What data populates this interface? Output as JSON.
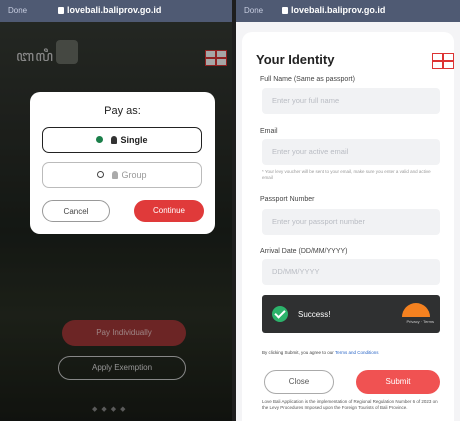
{
  "left": {
    "browser_label": "Done",
    "url": "lovebali.baliprov.go.id",
    "modal": {
      "title": "Pay as:",
      "option_single": "Single",
      "option_group": "Group",
      "cancel_label": "Cancel",
      "continue_label": "Continue"
    },
    "pay_individually": "Pay Individually",
    "apply_exemption": "Apply Exemption"
  },
  "right": {
    "browser_label": "Done",
    "url": "lovebali.baliprov.go.id",
    "heading": "Your Identity",
    "fields": {
      "full_name_label": "Full Name (Same as passport)",
      "full_name_placeholder": "Enter your full name",
      "email_label": "Email",
      "email_placeholder": "Enter your active email",
      "email_hint": "* Your levy voucher will be sent to your email, make sure you enter a valid and active email",
      "passport_label": "Passport Number",
      "passport_placeholder": "Enter your passport number",
      "arrival_label": "Arrival Date (DD/MM/YYYY)",
      "arrival_placeholder": "DD/MM/YYYY"
    },
    "captcha_status": "Success!",
    "captcha_brand": "Privacy · Terms",
    "terms_text": "By clicking Submit, you agree to our",
    "terms_link": "Terms and Conditions",
    "close_label": "Close",
    "submit_label": "Submit",
    "footer_text": "Love Bali Application is the implementation of Regional Regulation Number 6 of 2023 on the Levy Procedures Imposed upon the Foreign Tourists of Bali Province."
  }
}
